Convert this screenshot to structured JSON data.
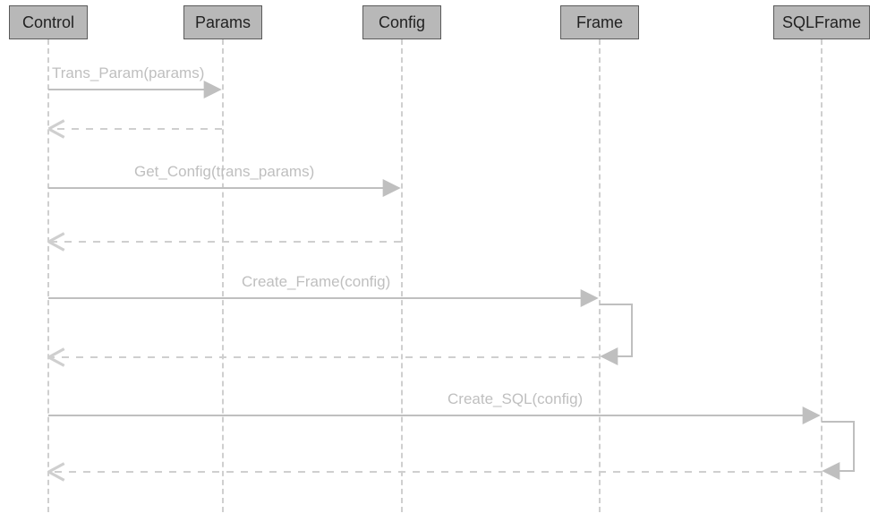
{
  "participants": {
    "control": "Control",
    "params": "Params",
    "config": "Config",
    "frame": "Frame",
    "sqlframe": "SQLFrame"
  },
  "messages": {
    "m1": "Trans_Param(params)",
    "m2": "Get_Config(trans_params)",
    "m3": "Create_Frame(config)",
    "m4": "Create_SQL(config)"
  },
  "chart_data": {
    "type": "sequence-diagram",
    "participants": [
      "Control",
      "Params",
      "Config",
      "Frame",
      "SQLFrame"
    ],
    "interactions": [
      {
        "from": "Control",
        "to": "Params",
        "label": "Trans_Param(params)",
        "return": true,
        "self_note": false
      },
      {
        "from": "Control",
        "to": "Config",
        "label": "Get_Config(trans_params)",
        "return": true,
        "self_note": false
      },
      {
        "from": "Control",
        "to": "Frame",
        "label": "Create_Frame(config)",
        "return": true,
        "self_note": true
      },
      {
        "from": "Control",
        "to": "SQLFrame",
        "label": "Create_SQL(config)",
        "return": true,
        "self_note": true
      }
    ]
  }
}
